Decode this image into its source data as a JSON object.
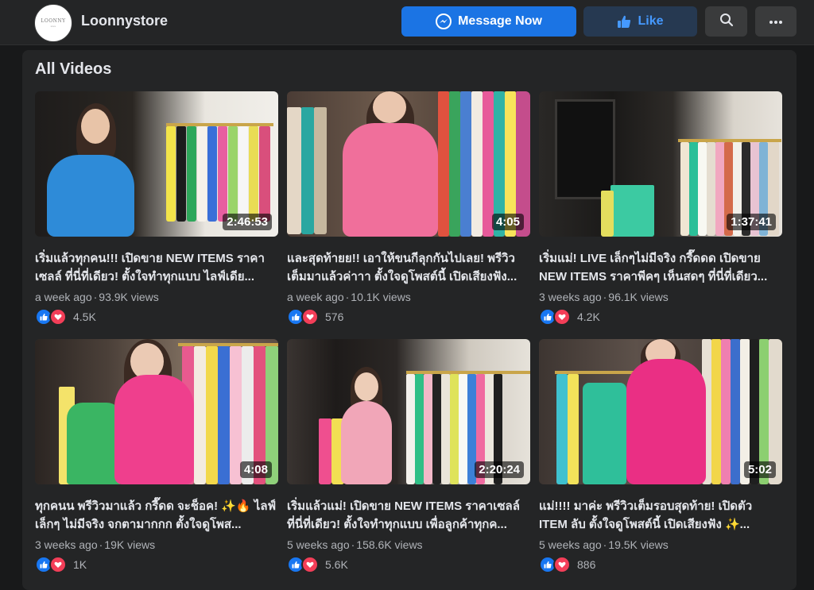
{
  "header": {
    "page_name": "Loonnystore",
    "logo_text": "LOONNY",
    "logo_subtext": "store",
    "message_label": "Message Now",
    "like_label": "Like"
  },
  "section": {
    "title": "All Videos"
  },
  "videos": [
    {
      "duration": "2:46:53",
      "title": "เริ่มแล้วทุกคน!!! เปิดขาย NEW ITEMS ราคาเซลล์ ที่นี่ที่เดียว! ตั้งใจทำทุกแบบ ไลฟ์เดีย...",
      "age": "a week ago",
      "views": "93.9K views",
      "reactions": "4.5K"
    },
    {
      "duration": "4:05",
      "title": "และสุดท้ายย!! เอาให้ขนกีลุกกันไปเลย! พรีวิวเต็มมาแล้วค่าาา ตั้งใจดูโพสต์นี้ เปิดเสียงฟัง...",
      "age": "a week ago",
      "views": "10.1K views",
      "reactions": "576"
    },
    {
      "duration": "1:37:41",
      "title": "เริ่มแม่! LIVE เล็กๆไม่มีจริง กรี๊ดดด เปิดขาย NEW ITEMS ราคาพีคๆ เห็นสดๆ ที่นี่ที่เดียว...",
      "age": "3 weeks ago",
      "views": "96.1K views",
      "reactions": "4.2K"
    },
    {
      "duration": "4:08",
      "title": "ทุกคนน พรีวิวมาแล้ว กรี๊ดด จะช็อค! ✨🔥 ไลฟ์เล็กๆ ไม่มีจริง จกตามากกก ตั้งใจดูโพส...",
      "age": "3 weeks ago",
      "views": "19K views",
      "reactions": "1K"
    },
    {
      "duration": "2:20:24",
      "title": "เริ่มแล้วแม่! เปิดขาย NEW ITEMS ราคาเซลล์ ที่นี่ที่เดียว! ตั้งใจทำทุกแบบ เพื่อลูกค้าทุกค...",
      "age": "5 weeks ago",
      "views": "158.6K views",
      "reactions": "5.6K"
    },
    {
      "duration": "5:02",
      "title": "แม่!!!! มาค่ะ พรีวิวเต็มรอบสุดท้าย! เปิดตัว ITEM ลับ ตั้งใจดูโพสต์นี้ เปิดเสียงฟัง ✨...",
      "age": "5 weeks ago",
      "views": "19.5K views",
      "reactions": "886"
    }
  ],
  "icons": {
    "messenger": "messenger-icon",
    "like": "thumbs-up-icon",
    "search": "search-icon",
    "more": "more-dots-icon",
    "reaction_like": "like-reaction-icon",
    "reaction_love": "love-reaction-icon"
  },
  "colors": {
    "background": "#18191a",
    "surface": "#242526",
    "primary": "#1b74e4",
    "like_bg": "#263951",
    "like_text": "#4599ff",
    "muted": "#b0b3b8"
  }
}
